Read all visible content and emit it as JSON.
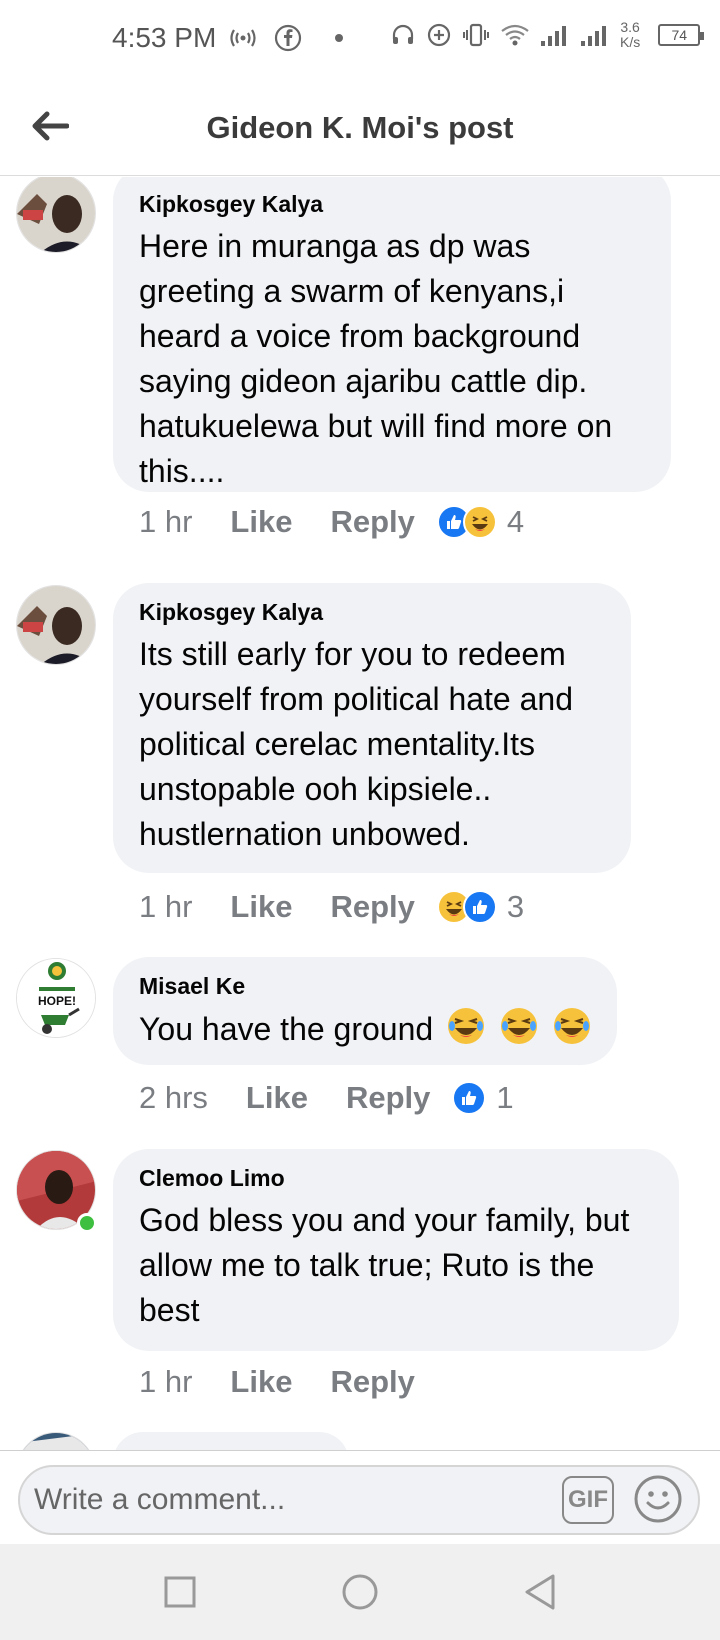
{
  "status_bar": {
    "time": "4:53 PM",
    "network_speed_value": "3.6",
    "network_speed_unit": "K/s",
    "battery": "74"
  },
  "header": {
    "title": "Gideon K. Moi's post"
  },
  "comments": [
    {
      "author": "Kipkosgey Kalya",
      "text": "Here in muranga as dp was greeting a swarm of kenyans,i heard a voice from background saying gideon ajaribu cattle dip. hatukuelewa but will find more on this....",
      "time": "1 hr",
      "like_label": "Like",
      "reply_label": "Reply",
      "reactions": [
        "like",
        "haha"
      ],
      "reaction_count": "4"
    },
    {
      "author": "Kipkosgey Kalya",
      "text": "Its still early for you to redeem yourself from political hate and political cerelac mentality.Its unstopable ooh kipsiele.. hustlernation unbowed.",
      "time": "1 hr",
      "like_label": "Like",
      "reply_label": "Reply",
      "reactions": [
        "haha",
        "like"
      ],
      "reaction_count": "3"
    },
    {
      "author": "Misael Ke",
      "text": "You have the ground",
      "time": "2 hrs",
      "like_label": "Like",
      "reply_label": "Reply",
      "reactions": [
        "like"
      ],
      "reaction_count": "1",
      "avatar_text": "HOPE!"
    },
    {
      "author": "Clemoo Limo",
      "text": "God bless you and your family, but allow me to talk true; Ruto is the best",
      "time": "1 hr",
      "like_label": "Like",
      "reply_label": "Reply",
      "online": true
    }
  ],
  "composer": {
    "placeholder": "Write a comment...",
    "gif_label": "GIF"
  },
  "icons": {
    "back": "arrow-left-icon",
    "emoji": "smiley-icon",
    "nav_recents": "square-icon",
    "nav_home": "circle-icon",
    "nav_back": "triangle-back-icon"
  },
  "colors": {
    "bubble_bg": "#f0f2f5",
    "like_blue": "#1877f2",
    "haha_yellow": "#f7c23b",
    "online_green": "#3fbf3f",
    "meta_gray": "#7a7d82"
  }
}
